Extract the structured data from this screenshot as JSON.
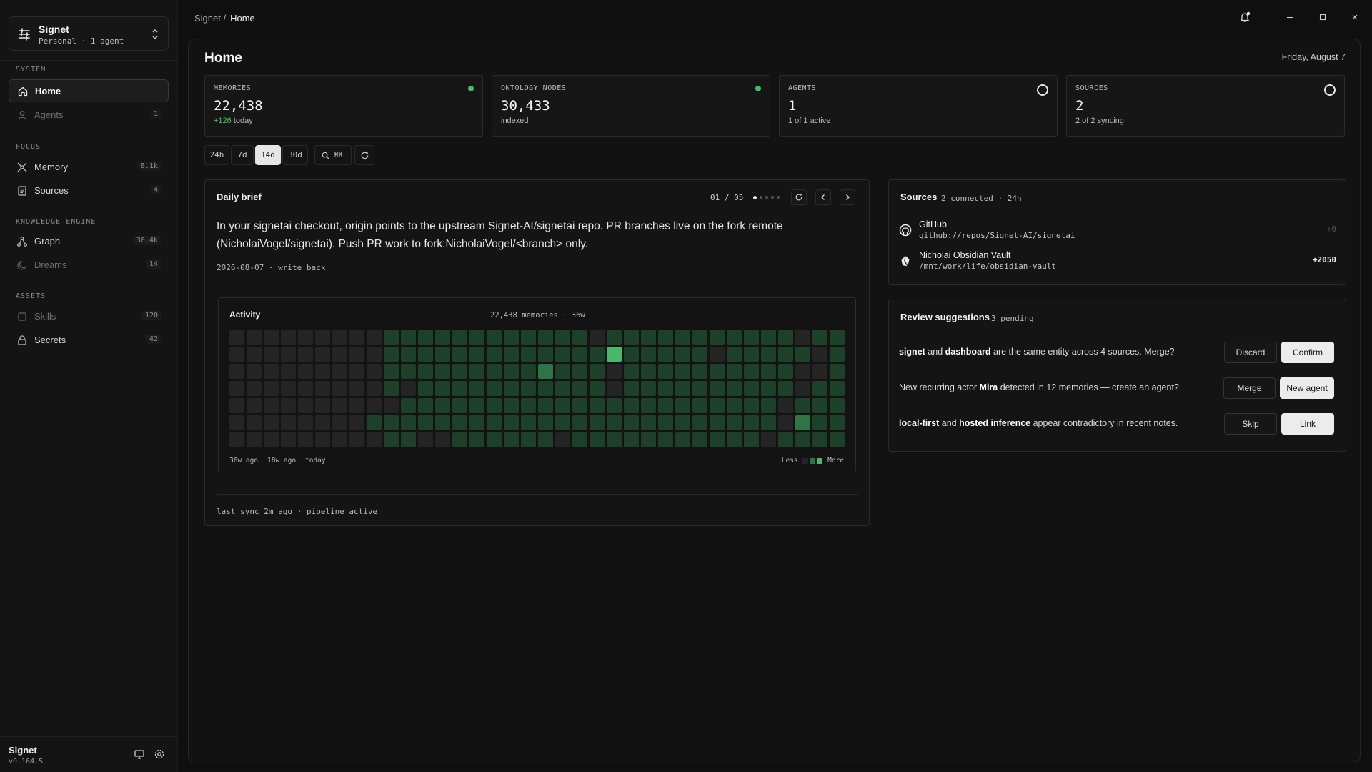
{
  "workspace": {
    "name": "Signet",
    "subtitle": "Personal · 1 agent"
  },
  "sidebar": {
    "sections": [
      {
        "label": "SYSTEM"
      },
      {
        "label": "FOCUS"
      },
      {
        "label": "KNOWLEDGE ENGINE"
      },
      {
        "label": "ASSETS"
      }
    ],
    "items": [
      {
        "label": "Home",
        "count": "",
        "icon": "home-icon",
        "active": true
      },
      {
        "label": "Agents",
        "count": "1",
        "icon": "user-icon"
      },
      {
        "label": "Memory",
        "count": "8.1k",
        "icon": "memory-icon"
      },
      {
        "label": "Sources",
        "count": "4",
        "icon": "sources-icon"
      },
      {
        "label": "Graph",
        "count": "30.4k",
        "icon": "graph-icon"
      },
      {
        "label": "Dreams",
        "count": "14",
        "icon": "moon-icon"
      },
      {
        "label": "Skills",
        "count": "120",
        "icon": "skills-icon"
      },
      {
        "label": "Secrets",
        "count": "42",
        "icon": "lock-icon"
      }
    ],
    "footer": {
      "name": "Signet",
      "version": "v0.164.5"
    }
  },
  "breadcrumb": {
    "root": "Signet /",
    "current": "Home"
  },
  "page": {
    "title": "Home",
    "date": "Friday, August 7"
  },
  "stats": [
    {
      "label": "MEMORIES",
      "value": "22,438",
      "sub_highlight": "+126",
      "sub": "today",
      "indicator": "dot"
    },
    {
      "label": "ONTOLOGY NODES",
      "value": "30,433",
      "sub_highlight": "",
      "sub": "indexed",
      "indicator": "dot"
    },
    {
      "label": "AGENTS",
      "value": "1",
      "sub_highlight": "",
      "sub": "1 of 1 active",
      "indicator": "ring"
    },
    {
      "label": "SOURCES",
      "value": "2",
      "sub_highlight": "",
      "sub": "2 of 2 syncing",
      "indicator": "ring"
    }
  ],
  "filters": {
    "ranges": [
      "24h",
      "7d",
      "14d",
      "30d"
    ],
    "selected": "14d",
    "search_label": "⌘K"
  },
  "brief": {
    "title": "Daily brief",
    "pager": "01 / 05",
    "text": "In your signetai checkout, origin points to the upstream Signet-AI/signetai repo. PR branches live on the fork remote (NicholaiVogel/signetai). Push PR work to fork:NicholaiVogel/<branch> only.",
    "meta": "2026-08-07 · write back",
    "footer": "last sync 2m ago · pipeline active"
  },
  "activity": {
    "title": "Activity",
    "meta": "22,438 memories · 36w",
    "axis": [
      "36w ago",
      "18w ago",
      "today"
    ],
    "legend_less": "Less",
    "legend_more": "More",
    "weeks": 36,
    "levels": [
      [
        0,
        0,
        0,
        0,
        0,
        0,
        0,
        0,
        0,
        1,
        1,
        1,
        1,
        1,
        1,
        1,
        1,
        1,
        1,
        1,
        1,
        0,
        1,
        1,
        1,
        1,
        1,
        1,
        1,
        1,
        1,
        1,
        1,
        0,
        1,
        1
      ],
      [
        0,
        0,
        0,
        0,
        0,
        0,
        0,
        0,
        0,
        1,
        1,
        1,
        1,
        1,
        1,
        1,
        1,
        1,
        1,
        1,
        1,
        1,
        3,
        1,
        1,
        1,
        1,
        1,
        0,
        1,
        1,
        1,
        1,
        1,
        0,
        1
      ],
      [
        0,
        0,
        0,
        0,
        0,
        0,
        0,
        0,
        0,
        1,
        1,
        1,
        1,
        1,
        1,
        1,
        1,
        1,
        2,
        1,
        1,
        1,
        0,
        1,
        1,
        1,
        1,
        1,
        1,
        1,
        1,
        1,
        1,
        0,
        0,
        1
      ],
      [
        0,
        0,
        0,
        0,
        0,
        0,
        0,
        0,
        0,
        1,
        0,
        1,
        1,
        1,
        1,
        1,
        1,
        1,
        1,
        1,
        1,
        1,
        0,
        1,
        1,
        1,
        1,
        1,
        1,
        1,
        1,
        1,
        1,
        0,
        1,
        1
      ],
      [
        0,
        0,
        0,
        0,
        0,
        0,
        0,
        0,
        0,
        0,
        1,
        1,
        1,
        1,
        1,
        1,
        1,
        1,
        1,
        1,
        1,
        1,
        1,
        1,
        1,
        1,
        1,
        1,
        1,
        1,
        1,
        1,
        0,
        1,
        1,
        1
      ],
      [
        0,
        0,
        0,
        0,
        0,
        0,
        0,
        0,
        1,
        1,
        1,
        1,
        1,
        1,
        1,
        1,
        1,
        1,
        1,
        1,
        1,
        1,
        1,
        1,
        1,
        1,
        1,
        1,
        1,
        1,
        1,
        1,
        0,
        2,
        1,
        1
      ],
      [
        0,
        0,
        0,
        0,
        0,
        0,
        0,
        0,
        0,
        1,
        1,
        0,
        0,
        1,
        1,
        1,
        1,
        1,
        1,
        0,
        1,
        1,
        1,
        1,
        1,
        1,
        1,
        1,
        1,
        1,
        1,
        0,
        1,
        1,
        1,
        1
      ]
    ],
    "level_colors": [
      "#242424",
      "#1d4029",
      "#2f7446",
      "#48b86a"
    ]
  },
  "sources_card": {
    "title": "Sources",
    "subtitle": "2 connected · 24h",
    "items": [
      {
        "name": "GitHub",
        "path": "github://repos/Signet-AI/signetai",
        "delta": "+0",
        "icon": "github-icon"
      },
      {
        "name": "Nicholai Obsidian Vault",
        "path": "/mnt/work/life/obsidian-vault",
        "delta": "+2050",
        "icon": "obsidian-icon"
      }
    ]
  },
  "review": {
    "title": "Review suggestions",
    "subtitle": "3 pending",
    "items": [
      {
        "b1": "signet",
        "t1": " and ",
        "b2": "dashboard",
        "t2": " are the same entity across 4 sources. Merge?",
        "secondary": "Discard",
        "primary": "Confirm"
      },
      {
        "b1": "",
        "t1": "New recurring actor ",
        "b2": "Mira",
        "t2": " detected in 12 memories — create an agent?",
        "secondary": "Merge",
        "primary": "New agent"
      },
      {
        "b1": "local-first",
        "t1": " and ",
        "b2": "hosted inference",
        "t2": " appear contradictory in recent notes.",
        "secondary": "Skip",
        "primary": "Link"
      }
    ]
  },
  "colors": {
    "accent_green": "#3fbf6a",
    "background": "#0f0f0f",
    "panel": "#141414"
  }
}
